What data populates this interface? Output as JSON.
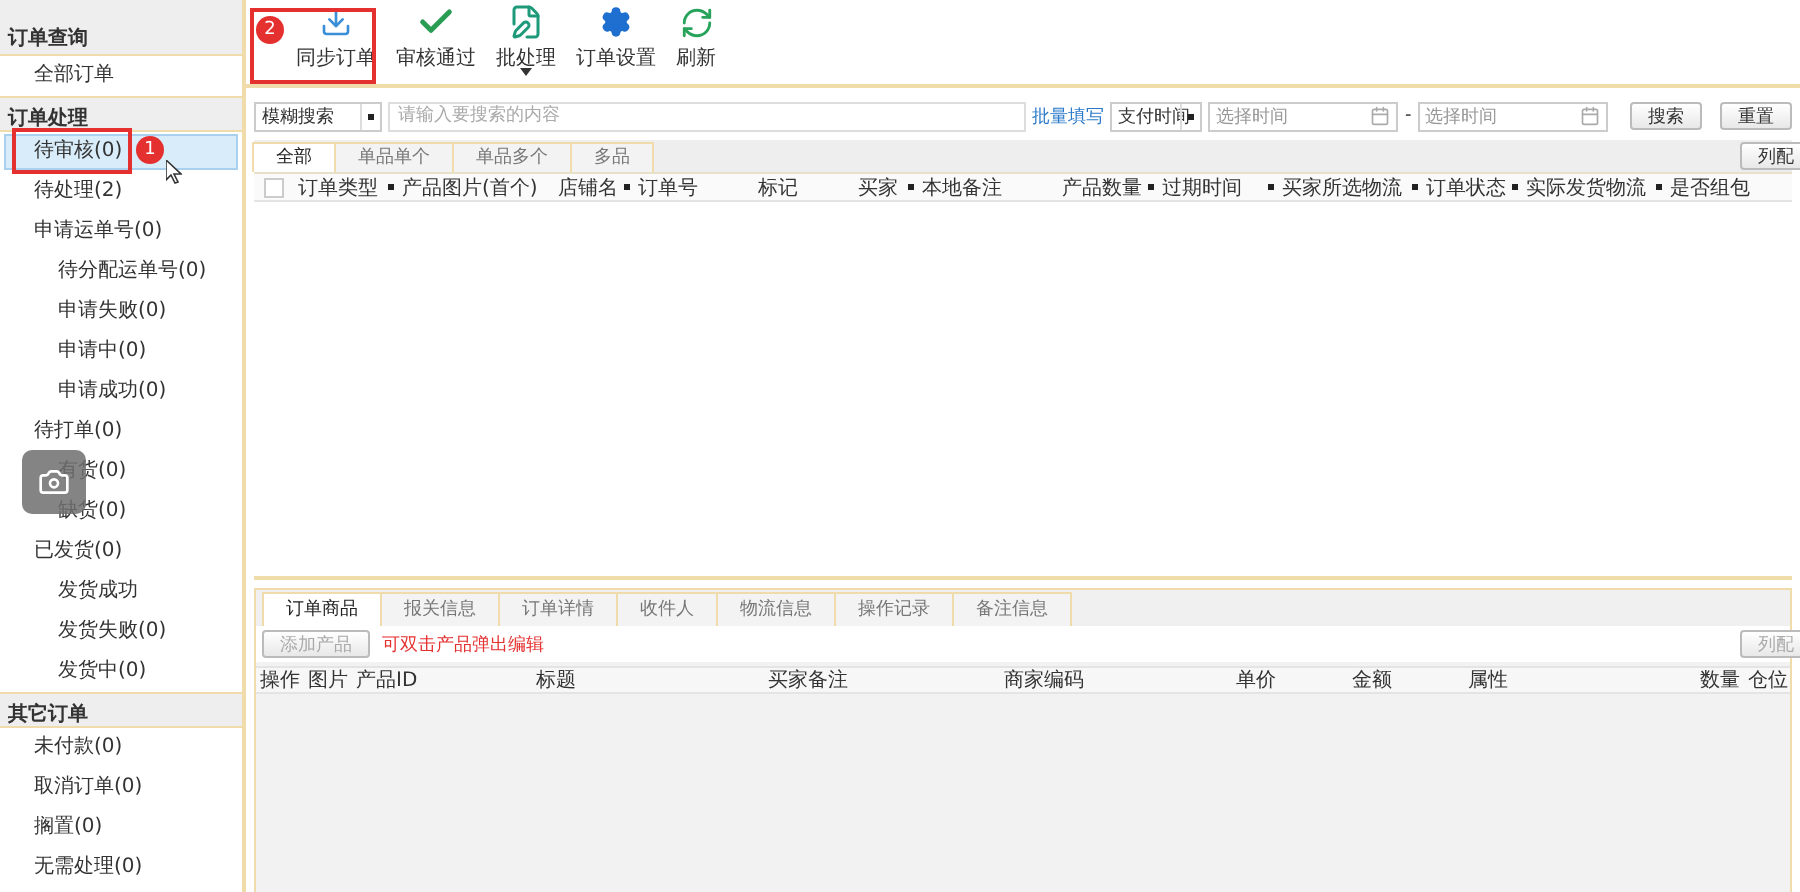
{
  "sidebar": {
    "sections": [
      {
        "title": "订单查询",
        "items": [
          {
            "label": "全部订单",
            "selected": false
          }
        ]
      },
      {
        "title": "订单处理",
        "items": [
          {
            "label": "待审核(0)",
            "selected": true
          },
          {
            "label": "待处理(2)",
            "selected": false
          },
          {
            "label": "申请运单号(0)",
            "selected": false,
            "children": [
              {
                "label": "待分配运单号(0)",
                "selected": false
              },
              {
                "label": "申请失败(0)",
                "selected": false
              },
              {
                "label": "申请中(0)",
                "selected": false
              },
              {
                "label": "申请成功(0)",
                "selected": false
              }
            ]
          },
          {
            "label": "待打单(0)",
            "selected": false,
            "children": [
              {
                "label": "有货(0)",
                "selected": false
              },
              {
                "label": "缺货(0)",
                "selected": false
              }
            ]
          },
          {
            "label": "已发货(0)",
            "selected": false,
            "children": [
              {
                "label": "发货成功",
                "selected": false
              },
              {
                "label": "发货失败(0)",
                "selected": false
              },
              {
                "label": "发货中(0)",
                "selected": false
              }
            ]
          }
        ]
      },
      {
        "title": "其它订单",
        "items": [
          {
            "label": "未付款(0)",
            "selected": false
          },
          {
            "label": "取消订单(0)",
            "selected": false
          },
          {
            "label": "搁置(0)",
            "selected": false
          },
          {
            "label": "无需处理(0)",
            "selected": false
          }
        ]
      }
    ]
  },
  "toolbar": [
    {
      "label": "同步订单",
      "has_menu": false
    },
    {
      "label": "审核通过",
      "has_menu": false
    },
    {
      "label": "批处理",
      "has_menu": true
    },
    {
      "label": "订单设置",
      "has_menu": false
    },
    {
      "label": "刷新",
      "has_menu": false
    }
  ],
  "annotations": [
    {
      "number": "1"
    },
    {
      "number": "2"
    }
  ],
  "search": {
    "mode": "模糊搜索",
    "placeholder": "请输入要搜索的内容",
    "batch_link": "批量填写",
    "time_type": "支付时间",
    "from_placeholder": "选择时间",
    "separator": "-",
    "to_placeholder": "选择时间",
    "buttons": [
      "搜索",
      "重置"
    ]
  },
  "tabs": [
    {
      "label": "全部",
      "selected": true
    },
    {
      "label": "单品单个",
      "selected": false
    },
    {
      "label": "单品多个",
      "selected": false
    },
    {
      "label": "多品",
      "selected": false
    }
  ],
  "column_config": "列配",
  "table": {
    "select_all_checked": false,
    "columns": [
      {
        "label": "订单类型",
        "sortable": true
      },
      {
        "label": "产品图片(首个)",
        "sortable": false
      },
      {
        "label": "店铺名",
        "sortable": true
      },
      {
        "label": "订单号",
        "sortable": false
      },
      {
        "label": "标记",
        "sortable": false
      },
      {
        "label": "买家",
        "sortable": true
      },
      {
        "label": "本地备注",
        "sortable": false
      },
      {
        "label": "产品数量",
        "sortable": true
      },
      {
        "label": "过期时间",
        "sortable": true
      },
      {
        "label": "买家所选物流",
        "sortable": true
      },
      {
        "label": "订单状态",
        "sortable": true
      },
      {
        "label": "实际发货物流",
        "sortable": true
      },
      {
        "label": "是否组包",
        "sortable": false
      }
    ]
  },
  "detail": {
    "tabs": [
      {
        "label": "订单商品",
        "selected": true
      },
      {
        "label": "报关信息",
        "selected": false
      },
      {
        "label": "订单详情",
        "selected": false
      },
      {
        "label": "收件人",
        "selected": false
      },
      {
        "label": "物流信息",
        "selected": false
      },
      {
        "label": "操作记录",
        "selected": false
      },
      {
        "label": "备注信息",
        "selected": false
      }
    ],
    "add_button": {
      "label": "添加产品",
      "disabled": true
    },
    "hint": "可双击产品弹出编辑",
    "column_config": {
      "label": "列配",
      "disabled": true
    },
    "columns": [
      "操作",
      "图片",
      "产品ID",
      "标题",
      "买家备注",
      "商家编码",
      "单价",
      "金额",
      "属性",
      "数量",
      "仓位"
    ]
  }
}
